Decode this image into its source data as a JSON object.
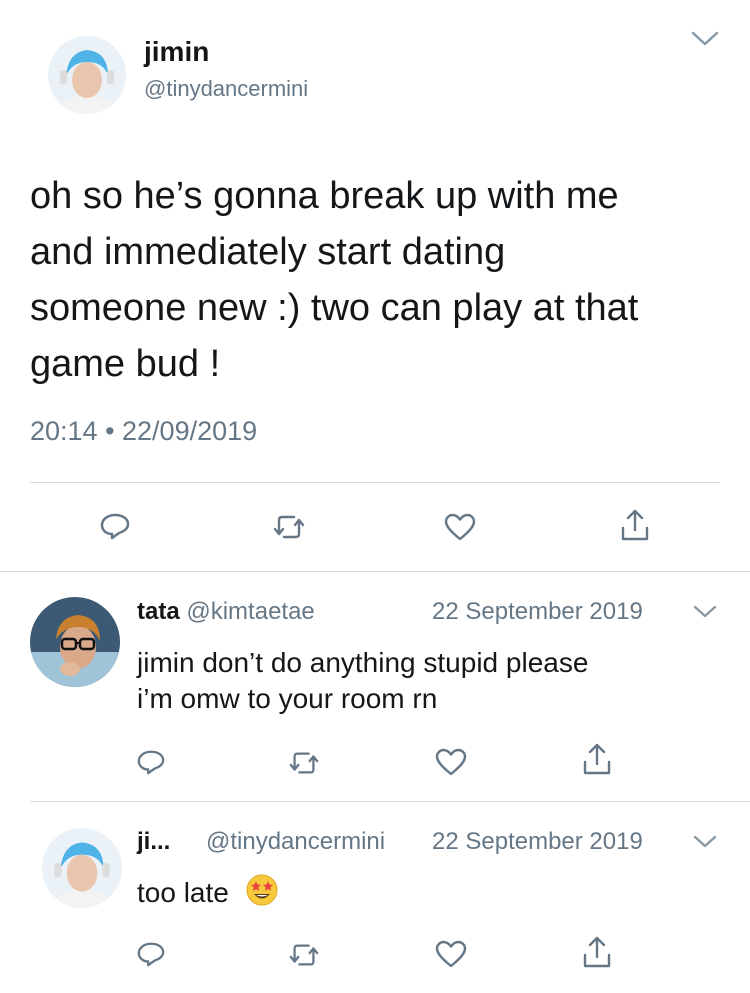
{
  "main_tweet": {
    "display_name": "jimin",
    "handle": "@tinydancermini",
    "text_lines": [
      "oh so he’s gonna break up with me",
      "and immediately start dating",
      "someone new :) two can play at that",
      "game bud !"
    ],
    "timestamp": "20:14 • 22/09/2019"
  },
  "replies": [
    {
      "display_name": "tata",
      "handle": "@kimtaetae",
      "date": "22 September 2019",
      "text_lines": [
        "jimin don’t do anything stupid please",
        "i’m omw to your room rn"
      ]
    },
    {
      "display_name": "ji...",
      "handle": "@tinydancermini",
      "date": "22 September 2019",
      "text_lines": [
        "too late"
      ],
      "emoji": "🤩"
    }
  ],
  "icons": {
    "reply": "reply-icon",
    "retweet": "retweet-icon",
    "like": "like-icon",
    "share": "share-icon",
    "menu": "chevron-down-icon"
  },
  "colors": {
    "text": "#14171a",
    "muted": "#657786",
    "icon": "#657786",
    "divider": "#d6d9dc",
    "avatar_hair": "#4fb3e8",
    "emoji_face": "#f9c93c"
  }
}
